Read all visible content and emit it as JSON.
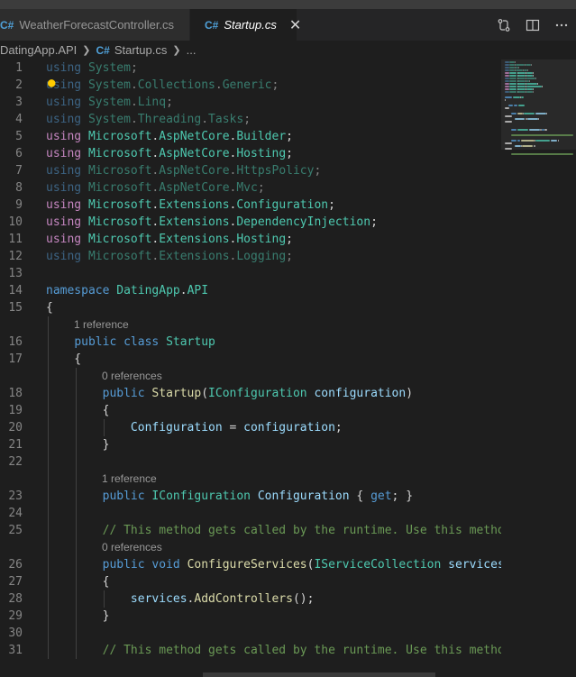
{
  "tabs": [
    {
      "label": "WeatherForecastController.cs",
      "active": false
    },
    {
      "label": "Startup.cs",
      "active": true
    }
  ],
  "tab_close_glyph": "✕",
  "actions": [
    "compare-changes-icon",
    "split-editor-icon",
    "more-actions-icon"
  ],
  "breadcrumb": {
    "project": "DatingApp.API",
    "file": "Startup.cs",
    "more": "..."
  },
  "colors": {
    "keyword": "#569cd6",
    "control": "#c586c0",
    "type": "#4ec9b0",
    "function": "#dcdcaa",
    "variable": "#9cdcfe",
    "text": "#d4d4d4",
    "comment": "#6a9955",
    "line_number": "#858585",
    "lightbulb": "#ffcc00"
  },
  "lines": [
    {
      "n": "1",
      "dim": true,
      "tokens": [
        [
          "kw",
          "using"
        ],
        [
          "txt",
          " "
        ],
        [
          "ns",
          "System"
        ],
        [
          "txt",
          ";"
        ]
      ]
    },
    {
      "n": "2",
      "dim": true,
      "tokens": [
        [
          "kw",
          "using"
        ],
        [
          "txt",
          " "
        ],
        [
          "ns",
          "System"
        ],
        [
          "txt",
          "."
        ],
        [
          "ns",
          "Collections"
        ],
        [
          "txt",
          "."
        ],
        [
          "ns",
          "Generic"
        ],
        [
          "txt",
          ";"
        ]
      ]
    },
    {
      "n": "3",
      "dim": true,
      "tokens": [
        [
          "kw",
          "using"
        ],
        [
          "txt",
          " "
        ],
        [
          "ns",
          "System"
        ],
        [
          "txt",
          "."
        ],
        [
          "ns",
          "Linq"
        ],
        [
          "txt",
          ";"
        ]
      ]
    },
    {
      "n": "4",
      "dim": true,
      "tokens": [
        [
          "kw",
          "using"
        ],
        [
          "txt",
          " "
        ],
        [
          "ns",
          "System"
        ],
        [
          "txt",
          "."
        ],
        [
          "ns",
          "Threading"
        ],
        [
          "txt",
          "."
        ],
        [
          "ns",
          "Tasks"
        ],
        [
          "txt",
          ";"
        ]
      ]
    },
    {
      "n": "5",
      "dim": false,
      "tokens": [
        [
          "ctrl",
          "using"
        ],
        [
          "txt",
          " "
        ],
        [
          "ns",
          "Microsoft"
        ],
        [
          "txt",
          "."
        ],
        [
          "ns",
          "AspNetCore"
        ],
        [
          "txt",
          "."
        ],
        [
          "ns",
          "Builder"
        ],
        [
          "txt",
          ";"
        ]
      ]
    },
    {
      "n": "6",
      "dim": false,
      "tokens": [
        [
          "ctrl",
          "using"
        ],
        [
          "txt",
          " "
        ],
        [
          "ns",
          "Microsoft"
        ],
        [
          "txt",
          "."
        ],
        [
          "ns",
          "AspNetCore"
        ],
        [
          "txt",
          "."
        ],
        [
          "ns",
          "Hosting"
        ],
        [
          "txt",
          ";"
        ]
      ]
    },
    {
      "n": "7",
      "dim": true,
      "tokens": [
        [
          "kw",
          "using"
        ],
        [
          "txt",
          " "
        ],
        [
          "ns",
          "Microsoft"
        ],
        [
          "txt",
          "."
        ],
        [
          "ns",
          "AspNetCore"
        ],
        [
          "txt",
          "."
        ],
        [
          "ns",
          "HttpsPolicy"
        ],
        [
          "txt",
          ";"
        ]
      ]
    },
    {
      "n": "8",
      "dim": true,
      "tokens": [
        [
          "kw",
          "using"
        ],
        [
          "txt",
          " "
        ],
        [
          "ns",
          "Microsoft"
        ],
        [
          "txt",
          "."
        ],
        [
          "ns",
          "AspNetCore"
        ],
        [
          "txt",
          "."
        ],
        [
          "ns",
          "Mvc"
        ],
        [
          "txt",
          ";"
        ]
      ]
    },
    {
      "n": "9",
      "dim": false,
      "tokens": [
        [
          "ctrl",
          "using"
        ],
        [
          "txt",
          " "
        ],
        [
          "ns",
          "Microsoft"
        ],
        [
          "txt",
          "."
        ],
        [
          "ns",
          "Extensions"
        ],
        [
          "txt",
          "."
        ],
        [
          "ns",
          "Configuration"
        ],
        [
          "txt",
          ";"
        ]
      ]
    },
    {
      "n": "10",
      "dim": false,
      "tokens": [
        [
          "ctrl",
          "using"
        ],
        [
          "txt",
          " "
        ],
        [
          "ns",
          "Microsoft"
        ],
        [
          "txt",
          "."
        ],
        [
          "ns",
          "Extensions"
        ],
        [
          "txt",
          "."
        ],
        [
          "ns",
          "DependencyInjection"
        ],
        [
          "txt",
          ";"
        ]
      ]
    },
    {
      "n": "11",
      "dim": false,
      "tokens": [
        [
          "ctrl",
          "using"
        ],
        [
          "txt",
          " "
        ],
        [
          "ns",
          "Microsoft"
        ],
        [
          "txt",
          "."
        ],
        [
          "ns",
          "Extensions"
        ],
        [
          "txt",
          "."
        ],
        [
          "ns",
          "Hosting"
        ],
        [
          "txt",
          ";"
        ]
      ]
    },
    {
      "n": "12",
      "dim": true,
      "tokens": [
        [
          "kw",
          "using"
        ],
        [
          "txt",
          " "
        ],
        [
          "ns",
          "Microsoft"
        ],
        [
          "txt",
          "."
        ],
        [
          "ns",
          "Extensions"
        ],
        [
          "txt",
          "."
        ],
        [
          "ns",
          "Logging"
        ],
        [
          "txt",
          ";"
        ]
      ]
    },
    {
      "n": "13",
      "tokens": []
    },
    {
      "n": "14",
      "tokens": [
        [
          "kw",
          "namespace"
        ],
        [
          "txt",
          " "
        ],
        [
          "ns",
          "DatingApp"
        ],
        [
          "txt",
          "."
        ],
        [
          "ns",
          "API"
        ]
      ]
    },
    {
      "n": "15",
      "tokens": [
        [
          "txt",
          "{"
        ]
      ]
    },
    {
      "lens": "1 reference",
      "indent": 1
    },
    {
      "n": "16",
      "tokens": [
        [
          "txt",
          "    "
        ],
        [
          "kw",
          "public"
        ],
        [
          "txt",
          " "
        ],
        [
          "kw",
          "class"
        ],
        [
          "txt",
          " "
        ],
        [
          "ty",
          "Startup"
        ]
      ]
    },
    {
      "n": "17",
      "tokens": [
        [
          "txt",
          "    {"
        ]
      ]
    },
    {
      "lens": "0 references",
      "indent": 2
    },
    {
      "n": "18",
      "tokens": [
        [
          "txt",
          "        "
        ],
        [
          "kw",
          "public"
        ],
        [
          "txt",
          " "
        ],
        [
          "fn",
          "Startup"
        ],
        [
          "txt",
          "("
        ],
        [
          "ty",
          "IConfiguration"
        ],
        [
          "txt",
          " "
        ],
        [
          "var",
          "configuration"
        ],
        [
          "txt",
          ")"
        ]
      ]
    },
    {
      "n": "19",
      "tokens": [
        [
          "txt",
          "        {"
        ]
      ]
    },
    {
      "n": "20",
      "tokens": [
        [
          "txt",
          "            "
        ],
        [
          "var",
          "Configuration"
        ],
        [
          "txt",
          " = "
        ],
        [
          "var",
          "configuration"
        ],
        [
          "txt",
          ";"
        ]
      ]
    },
    {
      "n": "21",
      "tokens": [
        [
          "txt",
          "        }"
        ]
      ]
    },
    {
      "n": "22",
      "tokens": []
    },
    {
      "lens": "1 reference",
      "indent": 2
    },
    {
      "n": "23",
      "tokens": [
        [
          "txt",
          "        "
        ],
        [
          "kw",
          "public"
        ],
        [
          "txt",
          " "
        ],
        [
          "ty",
          "IConfiguration"
        ],
        [
          "txt",
          " "
        ],
        [
          "var",
          "Configuration"
        ],
        [
          "txt",
          " { "
        ],
        [
          "kw",
          "get"
        ],
        [
          "txt",
          "; }"
        ]
      ]
    },
    {
      "n": "24",
      "tokens": []
    },
    {
      "n": "25",
      "tokens": [
        [
          "txt",
          "        "
        ],
        [
          "cmt",
          "// This method gets called by the runtime. Use this method to add services to the container."
        ]
      ]
    },
    {
      "lens": "0 references",
      "indent": 2
    },
    {
      "n": "26",
      "tokens": [
        [
          "txt",
          "        "
        ],
        [
          "kw",
          "public"
        ],
        [
          "txt",
          " "
        ],
        [
          "kw",
          "void"
        ],
        [
          "txt",
          " "
        ],
        [
          "fn",
          "ConfigureServices"
        ],
        [
          "txt",
          "("
        ],
        [
          "ty",
          "IServiceCollection"
        ],
        [
          "txt",
          " "
        ],
        [
          "var",
          "services"
        ],
        [
          "txt",
          ")"
        ]
      ]
    },
    {
      "n": "27",
      "tokens": [
        [
          "txt",
          "        {"
        ]
      ]
    },
    {
      "n": "28",
      "tokens": [
        [
          "txt",
          "            "
        ],
        [
          "var",
          "services"
        ],
        [
          "txt",
          "."
        ],
        [
          "fn",
          "AddControllers"
        ],
        [
          "txt",
          "();"
        ]
      ]
    },
    {
      "n": "29",
      "tokens": [
        [
          "txt",
          "        }"
        ]
      ]
    },
    {
      "n": "30",
      "tokens": []
    },
    {
      "n": "31",
      "tokens": [
        [
          "txt",
          "        "
        ],
        [
          "cmt",
          "// This method gets called by the runtime. Use this method to configure the HTTP request pipeline."
        ]
      ]
    }
  ]
}
